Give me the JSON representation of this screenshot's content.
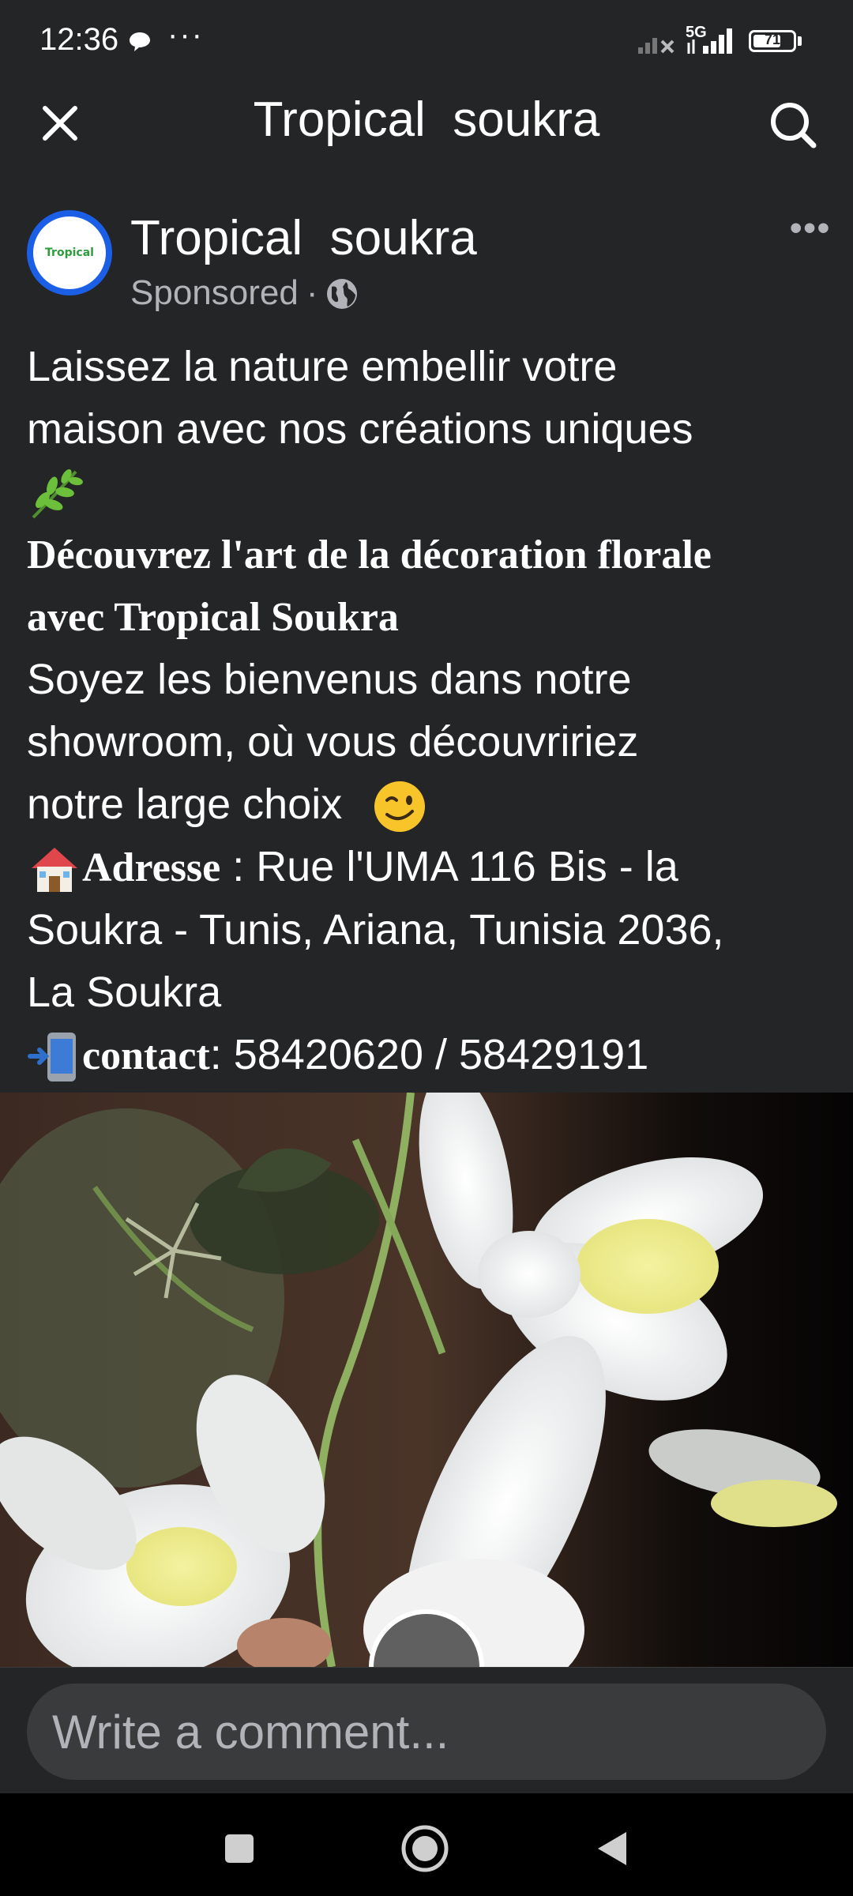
{
  "status_bar": {
    "time": "12:36",
    "more": "···",
    "network": "5G",
    "battery": "71",
    "battery_level": 0.71
  },
  "header": {
    "title": "Tropical  soukra",
    "close_icon": "close-icon",
    "search_icon": "search-icon"
  },
  "post": {
    "page_name": "Tropical  soukra",
    "avatar_text": "Tropical",
    "sponsored": "Sponsored",
    "separator": "·",
    "audience_icon": "globe-icon",
    "more": "•••",
    "lines": {
      "l1": "Laissez la nature embellir votre",
      "l2": "maison avec nos créations uniques",
      "l4": "Découvrez l'art de la décoration florale",
      "l5": "avec Tropical Soukra",
      "l6": "Soyez les bienvenus dans notre",
      "l7": "showroom, où vous découvririez",
      "l8": "notre large choix",
      "l9_label": "Adresse",
      "l9_rest": " : Rue l'UMA 116 Bis - la",
      "l10": "Soukra - Tunis, Ariana, Tunisia 2036,",
      "l11": "La Soukra",
      "l12_label": "contact",
      "l12_rest": ": 58420620 / 58429191"
    }
  },
  "comment": {
    "placeholder": "Write a comment..."
  },
  "colors": {
    "background": "#242526",
    "text": "#ffffff",
    "secondary_text": "#b0b3b8",
    "avatar_ring": "#1b5fe6",
    "input_bg": "#3a3b3c"
  }
}
